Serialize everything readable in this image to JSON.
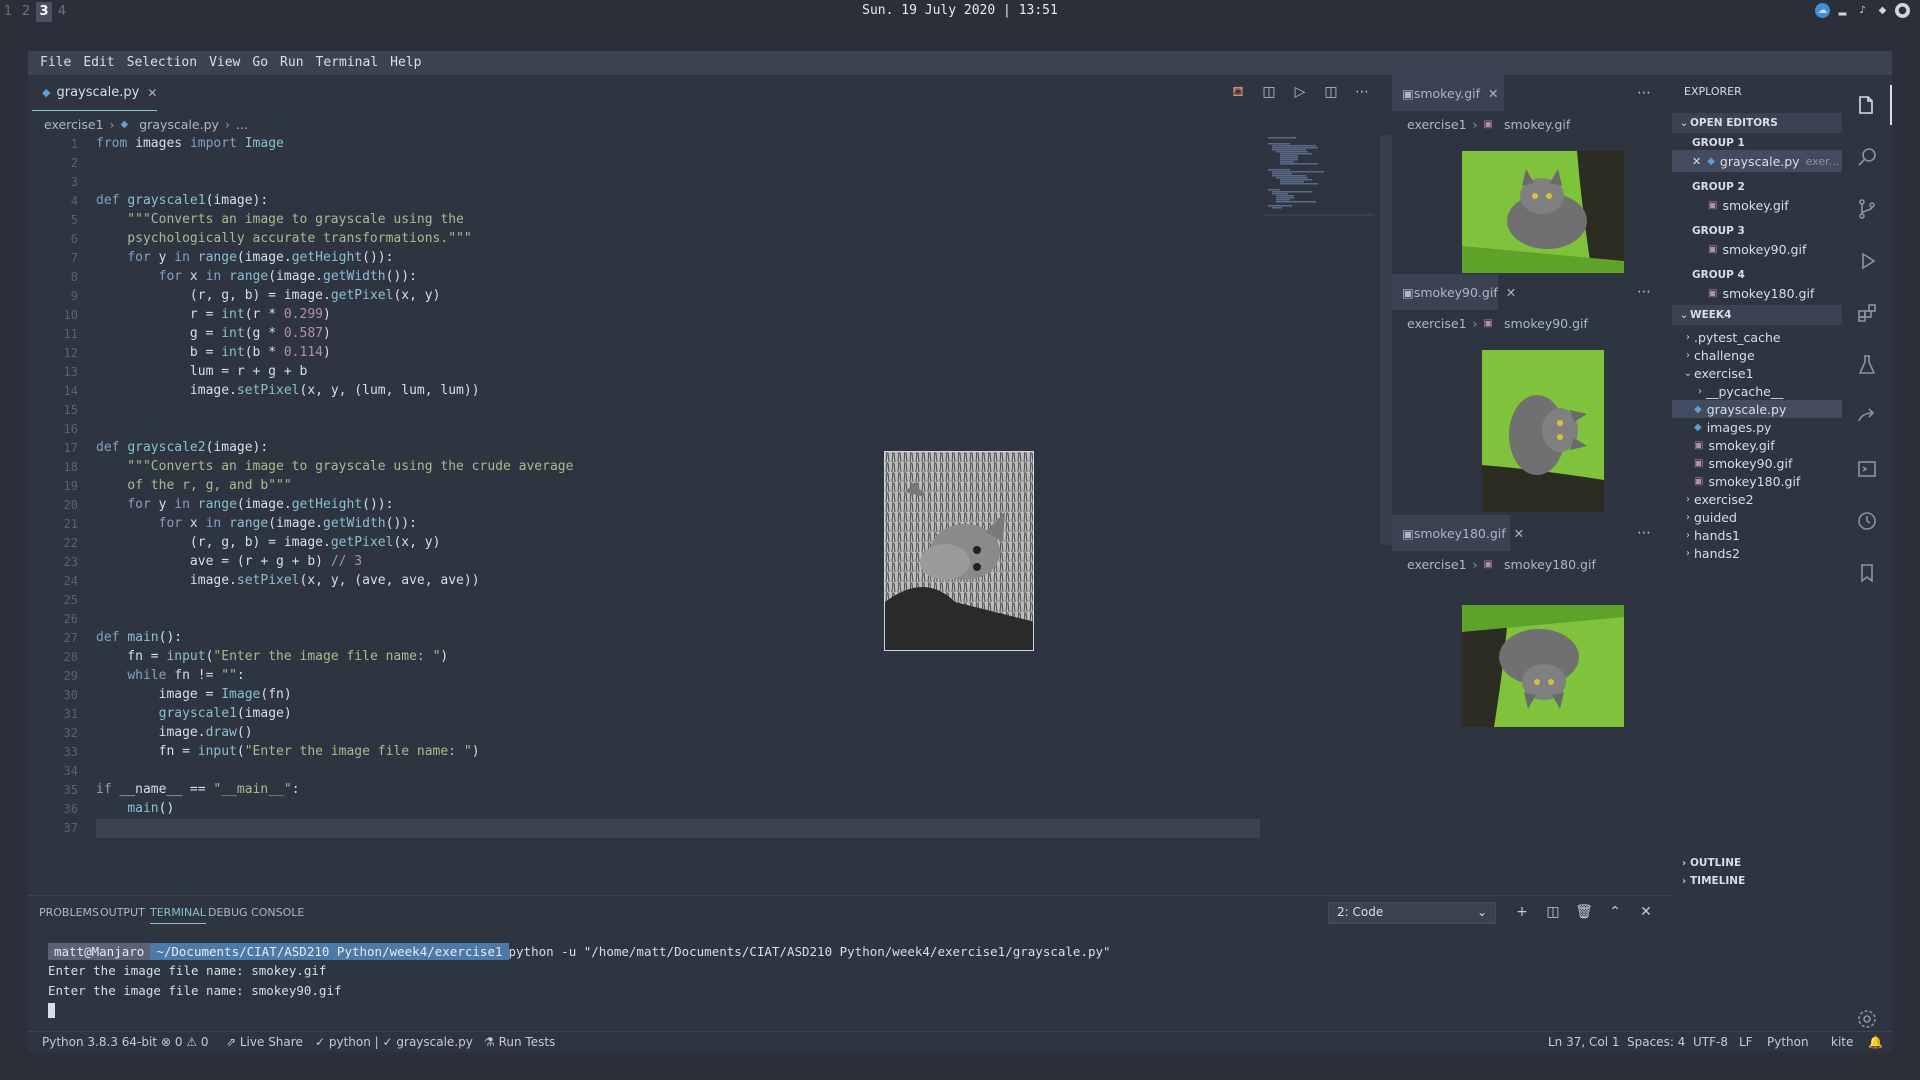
{
  "system": {
    "workspaces": [
      "1",
      "2",
      "3",
      "4"
    ],
    "active_workspace": "3",
    "datetime": "Sun. 19 July 2020  |  13:51"
  },
  "menu": [
    "File",
    "Edit",
    "Selection",
    "View",
    "Go",
    "Run",
    "Terminal",
    "Help"
  ],
  "editor": {
    "tab_label": "grayscale.py",
    "breadcrumb": [
      "exercise1",
      "grayscale.py",
      "..."
    ],
    "lines": [
      "from images import Image",
      "",
      "",
      "def grayscale1(image):",
      "    \"\"\"Converts an image to grayscale using the",
      "    psychologically accurate transformations.\"\"\"",
      "    for y in range(image.getHeight()):",
      "        for x in range(image.getWidth()):",
      "            (r, g, b) = image.getPixel(x, y)",
      "            r = int(r * 0.299)",
      "            g = int(g * 0.587)",
      "            b = int(b * 0.114)",
      "            lum = r + g + b",
      "            image.setPixel(x, y, (lum, lum, lum))",
      "",
      "",
      "def grayscale2(image):",
      "    \"\"\"Converts an image to grayscale using the crude average",
      "    of the r, g, and b\"\"\"",
      "    for y in range(image.getHeight()):",
      "        for x in range(image.getWidth()):",
      "            (r, g, b) = image.getPixel(x, y)",
      "            ave = (r + g + b) // 3",
      "            image.setPixel(x, y, (ave, ave, ave))",
      "",
      "",
      "def main():",
      "    fn = input(\"Enter the image file name: \")",
      "    while fn != \"\":",
      "        image = Image(fn)",
      "        grayscale1(image)",
      "        image.draw()",
      "        fn = input(\"Enter the image file name: \")",
      "",
      "if __name__ == \"__main__\":",
      "    main()",
      ""
    ]
  },
  "previews": [
    {
      "tab": "smokey.gif",
      "breadcrumb": [
        "exercise1",
        "smokey.gif"
      ]
    },
    {
      "tab": "smokey90.gif",
      "breadcrumb": [
        "exercise1",
        "smokey90.gif"
      ]
    },
    {
      "tab": "smokey180.gif",
      "breadcrumb": [
        "exercise1",
        "smokey180.gif"
      ]
    }
  ],
  "explorer": {
    "title": "EXPLORER",
    "open_editors": "OPEN EDITORS",
    "groups": [
      {
        "label": "GROUP 1",
        "file": "grayscale.py",
        "hint": "exer..."
      },
      {
        "label": "GROUP 2",
        "file": "smokey.gif"
      },
      {
        "label": "GROUP 3",
        "file": "smokey90.gif"
      },
      {
        "label": "GROUP 4",
        "file": "smokey180.gif"
      }
    ],
    "workspace": "WEEK4",
    "tree": [
      {
        "label": ".pytest_cache",
        "type": "folder",
        "depth": 0
      },
      {
        "label": "challenge",
        "type": "folder",
        "depth": 0
      },
      {
        "label": "exercise1",
        "type": "folder-open",
        "depth": 0
      },
      {
        "label": "__pycache__",
        "type": "folder",
        "depth": 1
      },
      {
        "label": "grayscale.py",
        "type": "py",
        "depth": 1
      },
      {
        "label": "images.py",
        "type": "py",
        "depth": 1
      },
      {
        "label": "smokey.gif",
        "type": "gif",
        "depth": 1
      },
      {
        "label": "smokey90.gif",
        "type": "gif",
        "depth": 1
      },
      {
        "label": "smokey180.gif",
        "type": "gif",
        "depth": 1
      },
      {
        "label": "exercise2",
        "type": "folder",
        "depth": 0
      },
      {
        "label": "guided",
        "type": "folder",
        "depth": 0
      },
      {
        "label": "hands1",
        "type": "folder",
        "depth": 0
      },
      {
        "label": "hands2",
        "type": "folder",
        "depth": 0
      }
    ],
    "outline": "OUTLINE",
    "timeline": "TIMELINE"
  },
  "panel": {
    "tabs": [
      "PROBLEMS",
      "OUTPUT",
      "TERMINAL",
      "DEBUG CONSOLE"
    ],
    "active_tab": "TERMINAL",
    "terminal_select": "2: Code",
    "prompt_user": "matt@Manjaro",
    "prompt_dir": "~/Documents/CIAT/ASD210 Python/week4/exercise1",
    "command": "python -u \"/home/matt/Documents/CIAT/ASD210 Python/week4/exercise1/grayscale.py\"",
    "output": [
      "Enter the image file name: smokey.gif",
      "Enter the image file name: smokey90.gif"
    ]
  },
  "status": {
    "python": "Python 3.8.3 64-bit",
    "problems": "⊗ 0 ⚠ 0",
    "liveshare": "Live Share",
    "checks": "✓ python | ✓ grayscale.py",
    "runtests": "Run Tests",
    "position": "Ln 37, Col 1",
    "spaces": "Spaces: 4",
    "encoding": "UTF-8",
    "eol": "LF",
    "language": "Python",
    "kite": "kite"
  },
  "colors": {
    "accent": "#88c0d0",
    "background": "#2e3440",
    "selection": "#434c5e"
  }
}
